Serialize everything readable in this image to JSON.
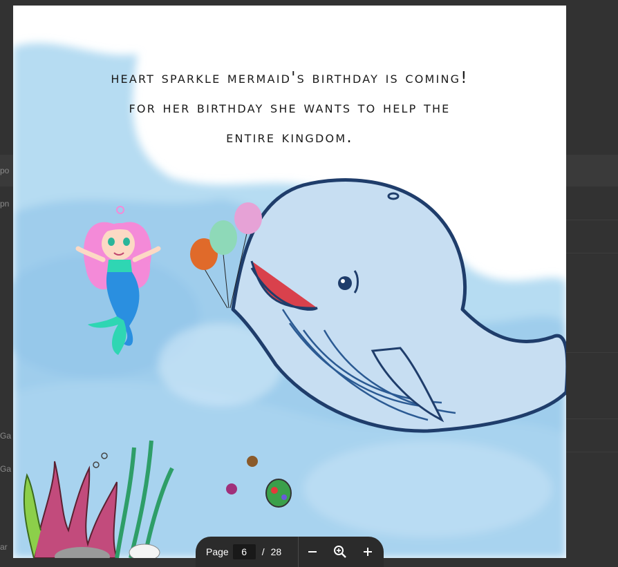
{
  "story": {
    "line1": "HEART SPARKLE MERMAID'S BIRTHDAY IS COMING!",
    "line2": "FOR HER BIRTHDAY SHE WANTS TO HELP THE",
    "line3": "ENTIRE KINGDOM."
  },
  "toolbar": {
    "page_label": "Page",
    "current_page": "6",
    "separator": "/",
    "total_pages": "28",
    "zoom_out_icon": "minus-icon",
    "fit_icon": "magnifier-icon",
    "zoom_in_icon": "plus-icon"
  },
  "background_fragments": {
    "f1": "po",
    "f2": "pn",
    "f3": "Ga",
    "f4": "Ga",
    "f5": "ar"
  },
  "colors": {
    "water": "#a9d4ee",
    "whale_outline": "#1f3d6b",
    "whale_fill": "#c7def2",
    "mermaid_hair": "#f48ad8",
    "mermaid_tail": "#2fd6b3",
    "toolbar_bg": "#2b2b2b",
    "page_input_bg": "#191919"
  }
}
